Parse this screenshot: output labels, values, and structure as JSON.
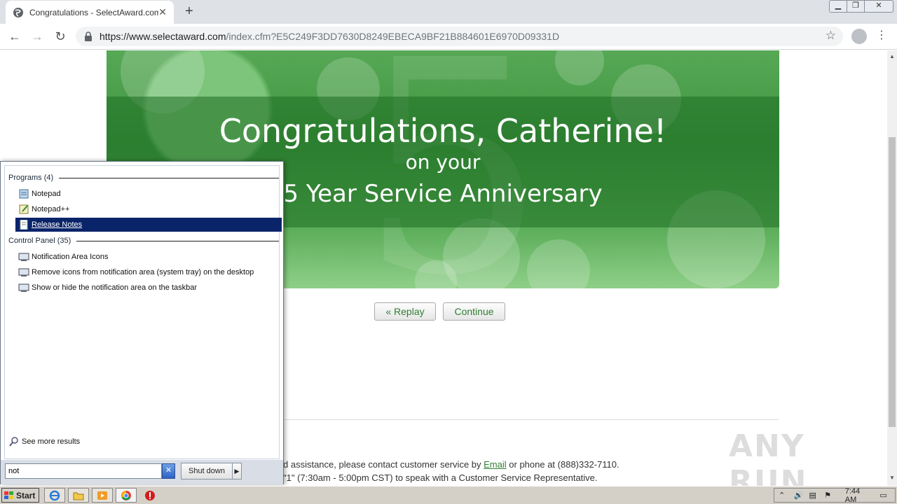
{
  "browser": {
    "tab_title": "Congratulations - SelectAward.com",
    "url_host": "https://www.selectaward.com",
    "url_path": "/index.cfm?E5C249F3DD7630D8249EBECA9BF21B884601E6970D09331D"
  },
  "page": {
    "banner": {
      "title": "Congratulations, Catherine!",
      "on_your": "on your",
      "anniversary": "5 Year Service Anniversary",
      "big_digit": "5"
    },
    "buttons": {
      "replay": "« Replay",
      "continue": "Continue"
    },
    "footer": {
      "line1_prefix": "d assistance, please contact customer service by ",
      "line1_link": "Email",
      "line1_suffix": " or phone at (888)332-7110.",
      "line2": "\"1\" (7:30am - 5:00pm CST) to speak with a Customer Service Representative."
    },
    "watermark": "ANY RUN"
  },
  "start_menu": {
    "programs_header": "Programs (4)",
    "programs": [
      {
        "label": "Notepad",
        "icon": "notepad-icon",
        "selected": false
      },
      {
        "label": "Notepad++",
        "icon": "notepadpp-icon",
        "selected": false
      },
      {
        "label": "Release Notes",
        "icon": "document-icon",
        "selected": true
      }
    ],
    "control_panel_header": "Control Panel (35)",
    "control_panel": [
      {
        "label": "Notification Area Icons",
        "icon": "control-panel-icon"
      },
      {
        "label": "Remove icons from notification area (system tray) on the desktop",
        "icon": "control-panel-icon"
      },
      {
        "label": "Show or hide the notification area on the taskbar",
        "icon": "control-panel-icon"
      }
    ],
    "see_more": "See more results",
    "search_value": "not",
    "shutdown_label": "Shut down"
  },
  "taskbar": {
    "start_label": "Start",
    "clock": "7:44 AM"
  },
  "colors": {
    "accent_green": "#2f7d32",
    "selection_blue": "#0a246a"
  }
}
